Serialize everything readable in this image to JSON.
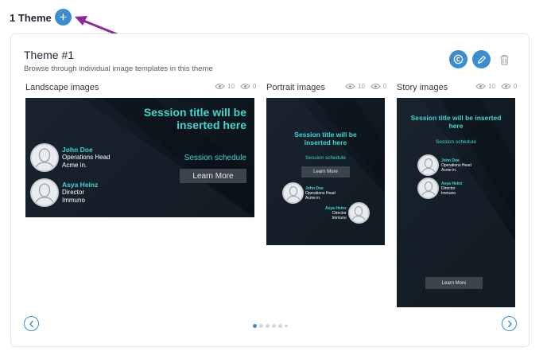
{
  "header": {
    "title": "1 Theme",
    "add_symbol": "+"
  },
  "theme": {
    "name": "Theme #1",
    "description": "Browse through individual image templates in this theme"
  },
  "sections": [
    {
      "title": "Landscape images",
      "views": "10",
      "other": "0"
    },
    {
      "title": "Portrait images",
      "views": "10",
      "other": "0"
    },
    {
      "title": "Story images",
      "views": "10",
      "other": "0"
    }
  ],
  "template": {
    "session_title": "Session title will be inserted here",
    "session_schedule": "Session schedule",
    "learn_more": "Learn More",
    "speakers": [
      {
        "name": "John Doe",
        "role": "Operations Head",
        "org": "Acme in."
      },
      {
        "name": "Asya Heinz",
        "role": "Director",
        "org": "Immuno"
      }
    ]
  },
  "pagination": {
    "total_dots": 6,
    "active_index": 0
  },
  "colors": {
    "accent": "#3a8dd0",
    "teal": "#3fd7d0",
    "arrow": "#8a2a9a",
    "dark_bg": "#121b24"
  },
  "icons": [
    "plus-icon",
    "copy-icon",
    "pencil-icon",
    "trash-icon",
    "eye-icon",
    "chevron-left-icon",
    "chevron-right-icon"
  ]
}
